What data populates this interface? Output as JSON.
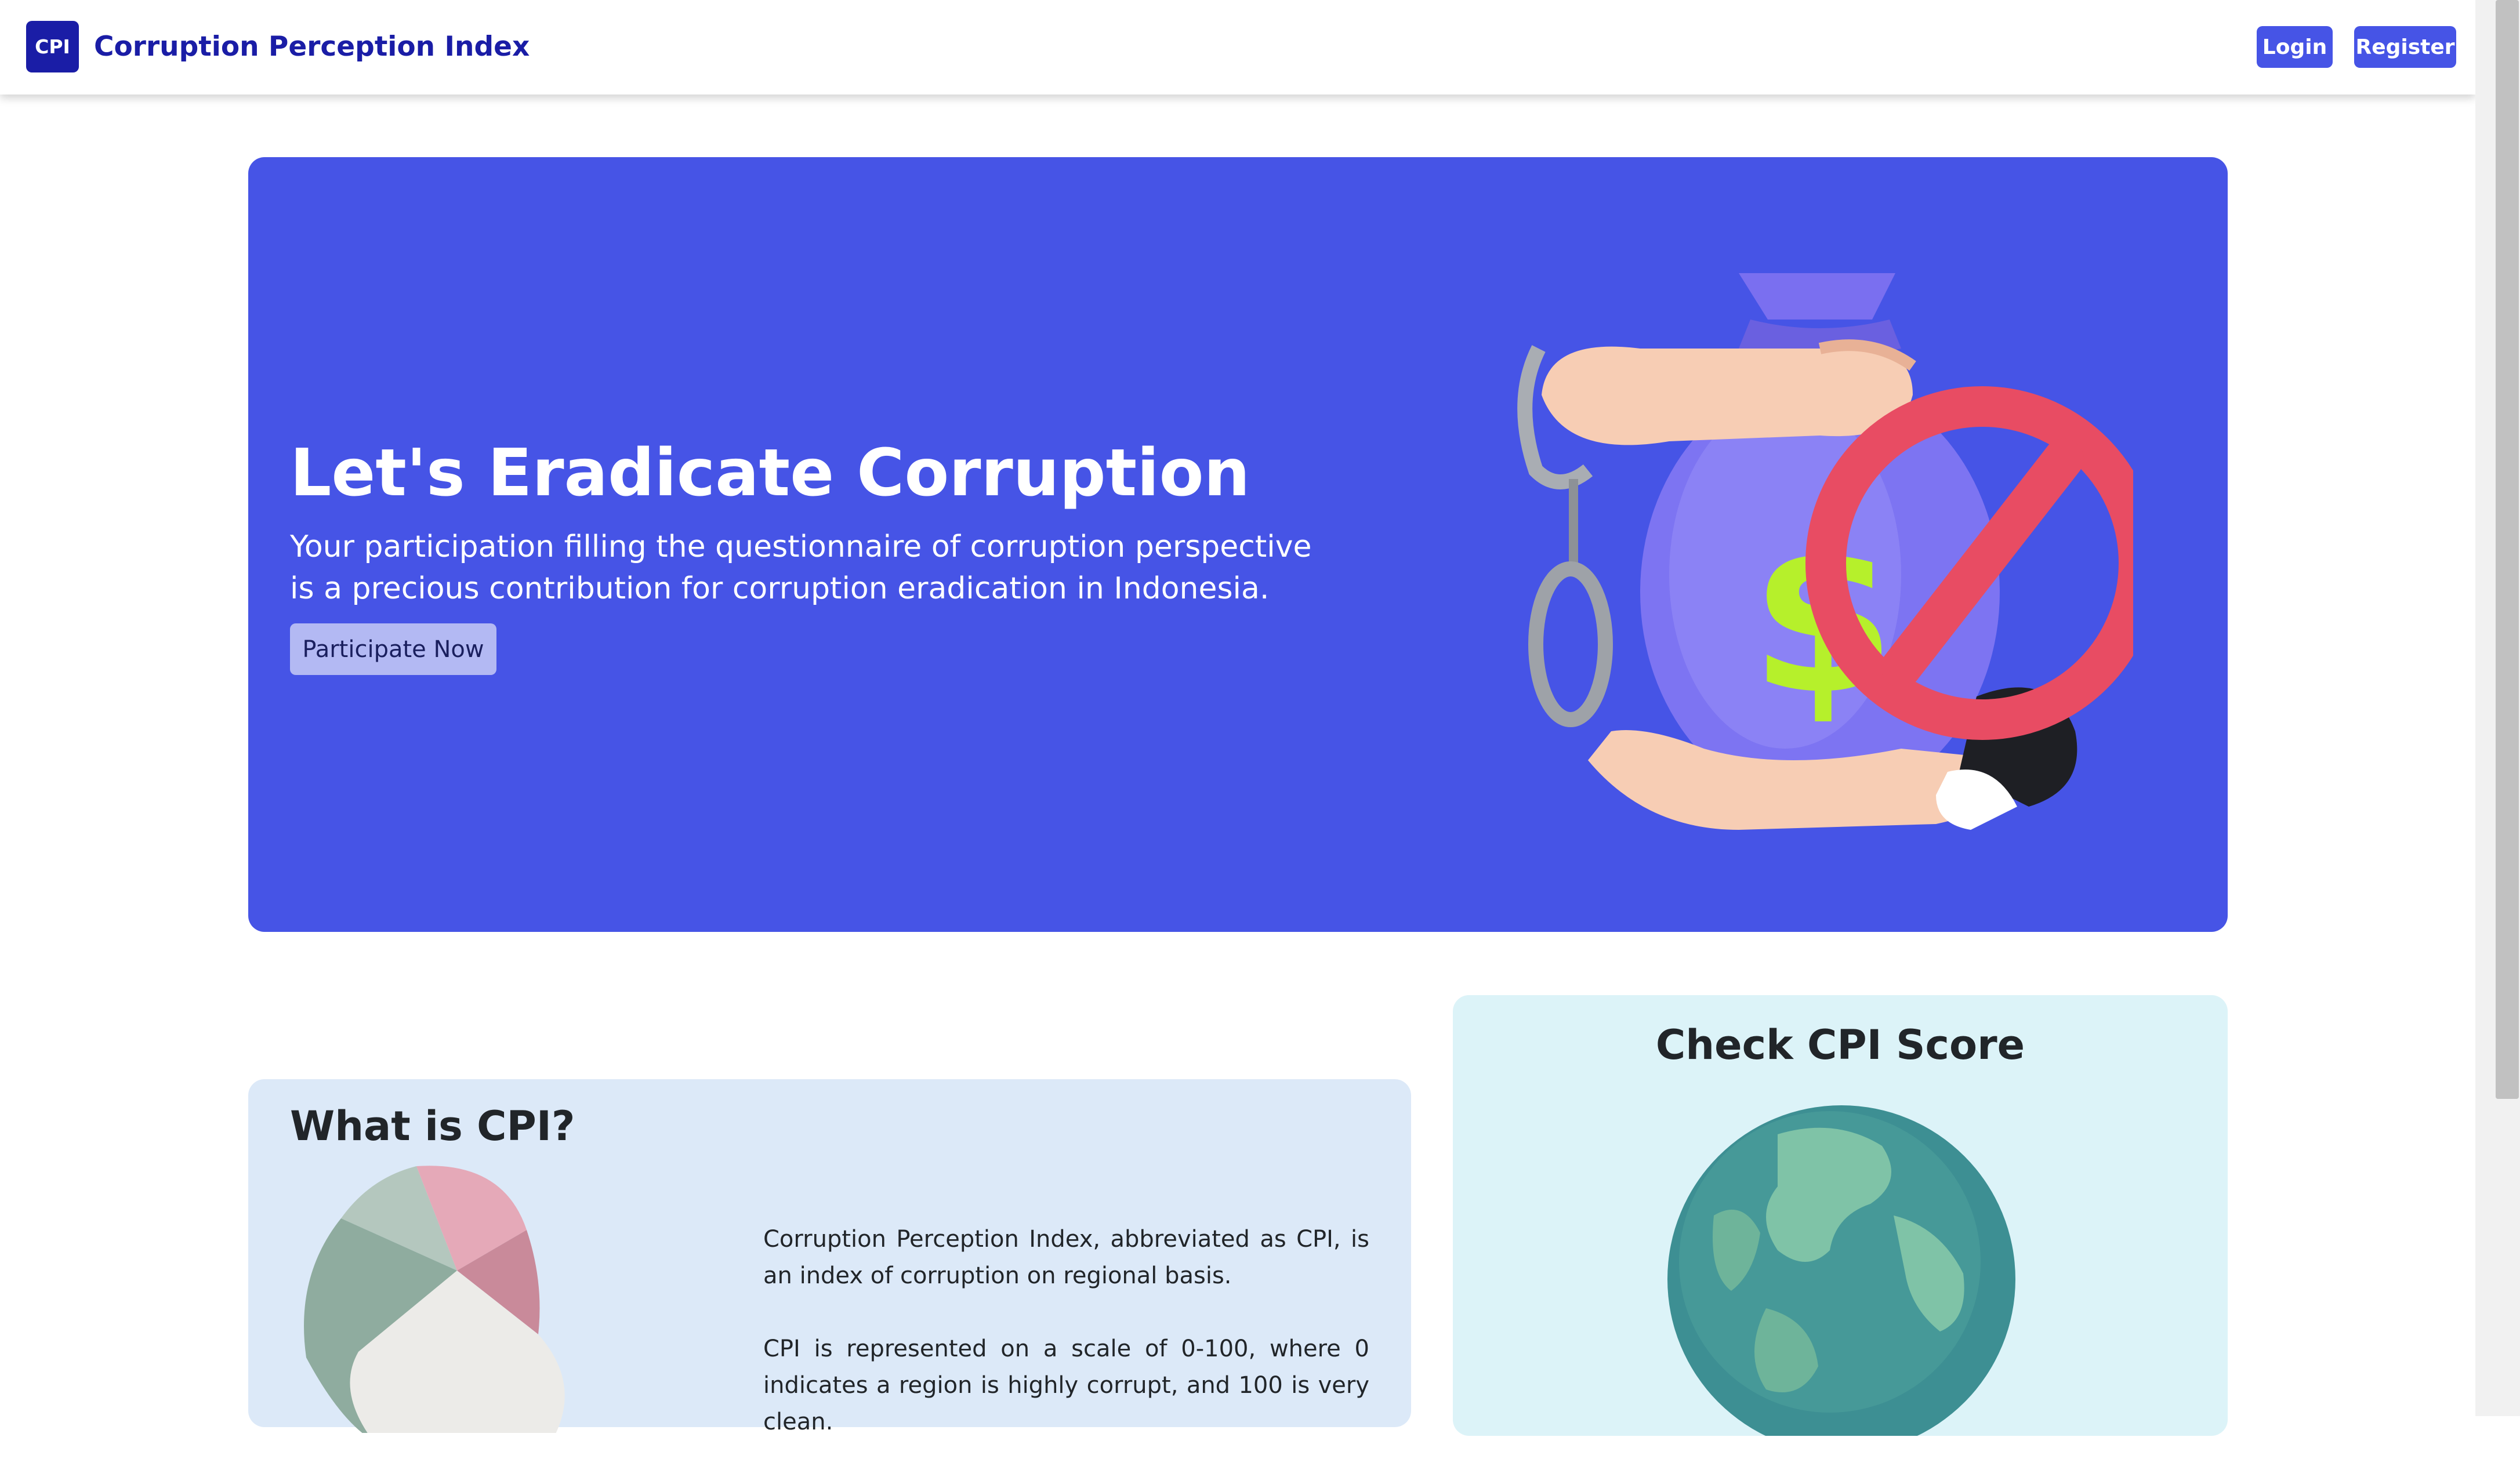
{
  "navbar": {
    "logo_text": "CPI",
    "brand_name": "Corruption Perception Index",
    "login_label": "Login",
    "register_label": "Register",
    "accent_color": "#1a1da6",
    "button_color": "#4654e6"
  },
  "hero": {
    "title": "Let's Eradicate Corruption",
    "description": "Your participation filling the questionnaire of corruption perspective is a precious contribution for corruption eradication in Indonesia.",
    "cta_label": "Participate Now",
    "background_color": "#4654e6",
    "illustration_icon": "anti-corruption-money-bag-icon"
  },
  "what_is_cpi": {
    "title": "What is CPI?",
    "paragraph_1": "Corruption Perception Index, abbreviated as CPI, is an index of corruption on regional basis.",
    "paragraph_2": "CPI is represented on a scale of 0-100, where 0 indicates a region is highly corrupt, and 100 is very clean.",
    "illustration_icon": "pie-chart-3d-icon"
  },
  "check_score": {
    "title": "Check CPI Score",
    "illustration_icon": "globe-icon"
  }
}
